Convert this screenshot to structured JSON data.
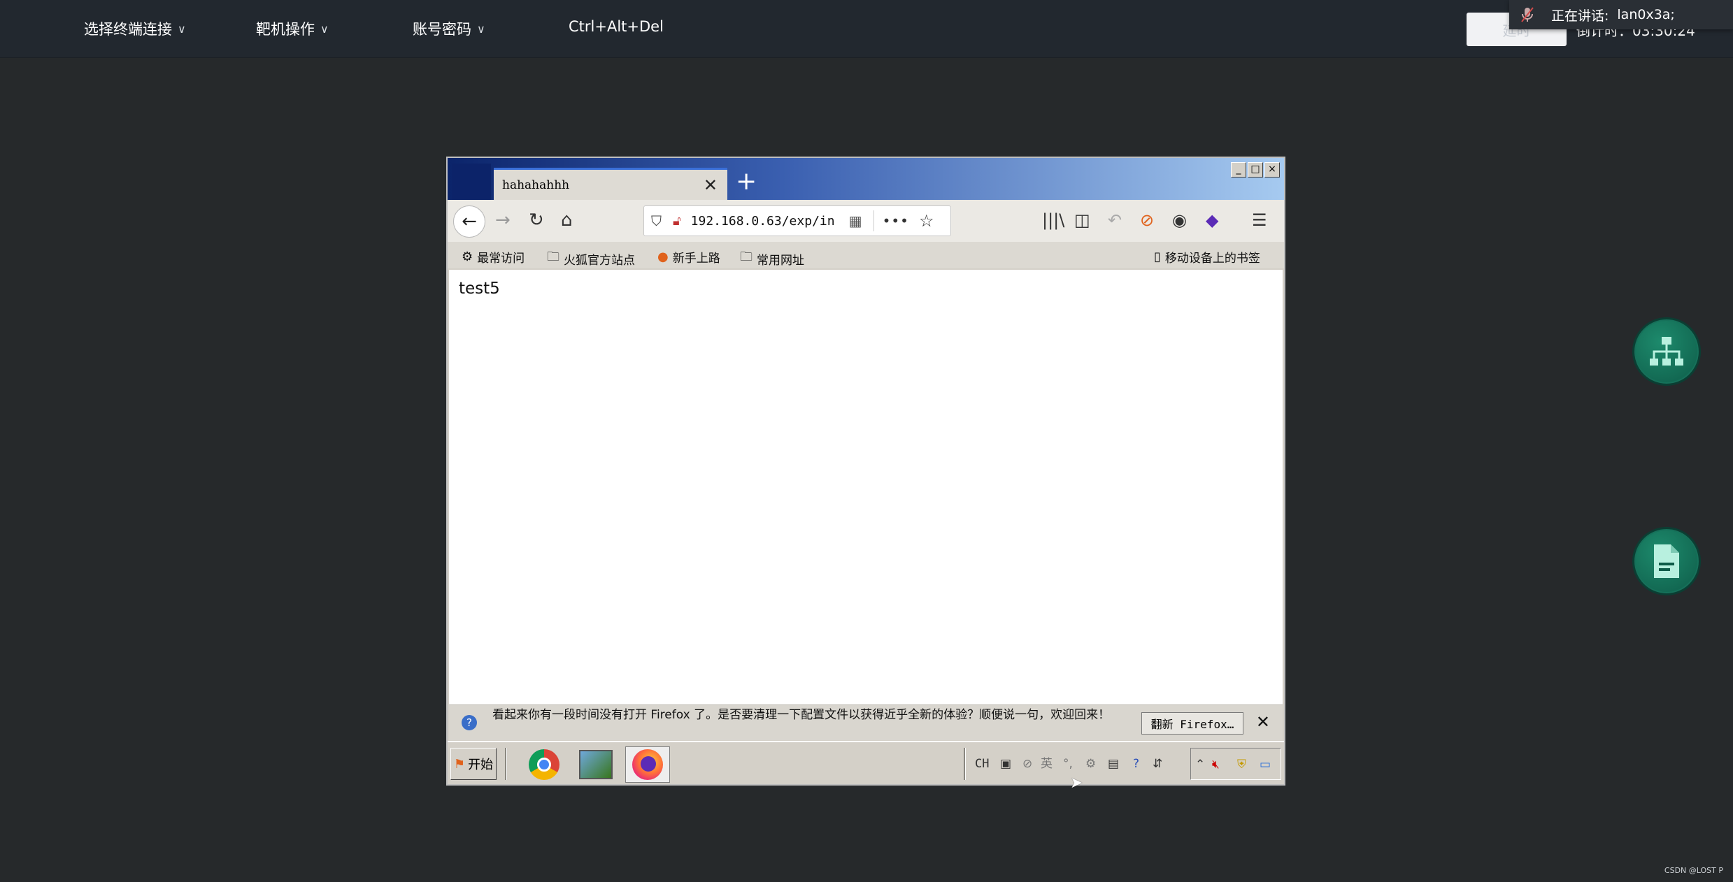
{
  "topbar": {
    "menu": [
      {
        "label": "选择终端连接",
        "icon": "chevron-down-icon"
      },
      {
        "label": "靶机操作",
        "icon": "chevron-down-icon"
      },
      {
        "label": "账号密码",
        "icon": "chevron-down-icon"
      }
    ],
    "ctrl_alt_del": "Ctrl+Alt+Del",
    "delay_button": "延时",
    "countdown": "倒计时：03:30:24",
    "speaking_label": "正在讲话:",
    "speaking_user": "lan0x3a;"
  },
  "browser": {
    "tab_title": "hahahahhh",
    "url": "192.168.0.63/exp/in",
    "bookmarks": [
      {
        "label": "最常访问",
        "icon": "gear-icon"
      },
      {
        "label": "火狐官方站点",
        "icon": "folder-icon"
      },
      {
        "label": "新手上路",
        "icon": "firefox-icon"
      },
      {
        "label": "常用网址",
        "icon": "folder-icon"
      }
    ],
    "mobile_bookmarks": "移动设备上的书签",
    "page_text": "test5",
    "notification": "看起来你有一段时间没有打开 Firefox 了。是否要清理一下配置文件以获得近乎全新的体验？顺便说一句，欢迎回来！",
    "refresh_button": "翻新 Firefox…"
  },
  "taskbar": {
    "start_label": "开始",
    "tray_lang": "CH",
    "tray_ime": "英"
  },
  "watermark": "CSDN @LOST P"
}
